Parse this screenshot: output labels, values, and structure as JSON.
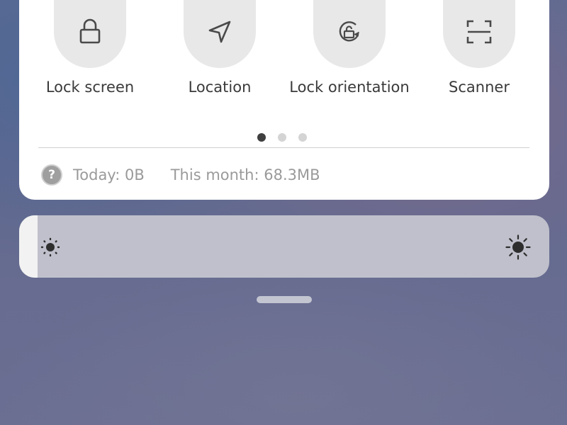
{
  "quick_settings": {
    "tiles": [
      {
        "label": "Lock screen",
        "icon": "padlock-icon",
        "active": false
      },
      {
        "label": "Location",
        "icon": "navigation-arrow-icon",
        "active": false
      },
      {
        "label": "Lock orientation",
        "icon": "rotation-lock-icon",
        "active": false
      },
      {
        "label": "Scanner",
        "icon": "scan-frame-icon",
        "active": false
      }
    ],
    "pages": {
      "count": 3,
      "current": 1
    },
    "data_usage": {
      "today": "Today: 0B",
      "this_month": "This month: 68.3MB"
    }
  },
  "brightness": {
    "level": 0.035,
    "low_icon": "brightness-low-icon",
    "high_icon": "brightness-high-icon"
  },
  "colors": {
    "card_background": "#ffffff",
    "tile_circle": "#e8e8e8",
    "icon_stroke": "#4a4a4a",
    "label_text": "#3a3a3a",
    "secondary_text": "#9a9a9a",
    "active_dot": "#3f3f3f",
    "inactive_dot": "#d4d4d4",
    "slider_track": "#bfc0cb",
    "slider_fill": "#f2f2f2"
  }
}
